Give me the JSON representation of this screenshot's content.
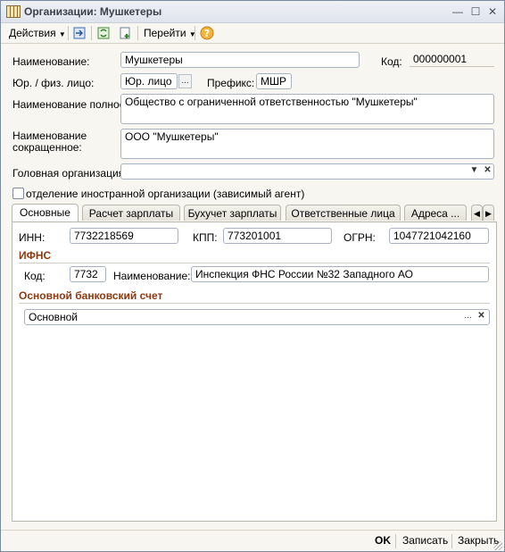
{
  "window": {
    "title": "Организации: Мушкетеры"
  },
  "toolbar": {
    "actions_label": "Действия",
    "goto_label": "Перейти"
  },
  "form": {
    "name_label": "Наименование:",
    "name_value": "Мушкетеры",
    "code_label": "Код:",
    "code_value": "000000001",
    "entity_label": "Юр. / физ. лицо:",
    "entity_value": "Юр. лицо",
    "prefix_label": "Префикс:",
    "prefix_value": "МШР",
    "fullname_label": "Наименование полное:",
    "fullname_value": "Общество с ограниченной ответственностью \"Мушкетеры\"",
    "shortname_label_1": "Наименование",
    "shortname_label_2": "сокращенное:",
    "shortname_value": "ООО \"Мушкетеры\"",
    "parent_label": "Головная организация:",
    "parent_value": "",
    "foreign_label": "отделение иностранной организации (зависимый агент)"
  },
  "tabs": [
    {
      "label": "Основные"
    },
    {
      "label": "Расчет зарплаты"
    },
    {
      "label": "Бухучет зарплаты"
    },
    {
      "label": "Ответственные лица"
    },
    {
      "label": "Адреса ..."
    }
  ],
  "main": {
    "inn_label": "ИНН:",
    "inn_value": "7732218569",
    "kpp_label": "КПП:",
    "kpp_value": "773201001",
    "ogrn_label": "ОГРН:",
    "ogrn_value": "1047721042160",
    "ifns_title": "ИФНС",
    "ifns_code_label": "Код:",
    "ifns_code_value": "7732",
    "ifns_name_label": "Наименование:",
    "ifns_name_value": "Инспекция ФНС России №32 Западного АО",
    "bank_title": "Основной банковский счет",
    "bank_value": "Основной"
  },
  "footer": {
    "ok_label": "OK",
    "save_label": "Записать",
    "close_label": "Закрыть"
  }
}
